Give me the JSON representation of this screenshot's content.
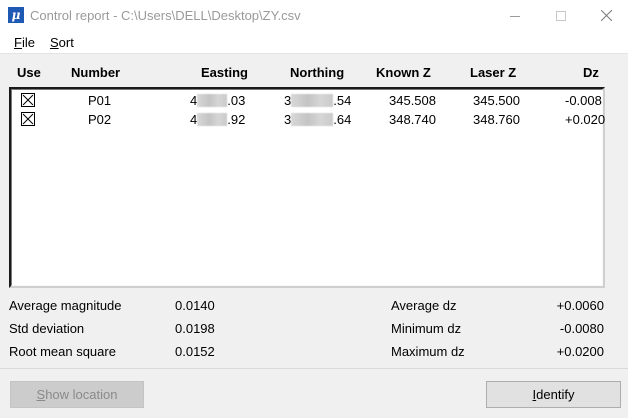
{
  "window": {
    "title": "Control report - C:\\Users\\DELL\\Desktop\\ZY.csv",
    "icon_glyph": "μ"
  },
  "menu": {
    "file_hotkey": "F",
    "file_rest": "ile",
    "sort_hotkey": "S",
    "sort_rest": "ort"
  },
  "columns": {
    "use": "Use",
    "number": "Number",
    "easting": "Easting",
    "northing": "Northing",
    "known_z": "Known Z",
    "laser_z": "Laser Z",
    "dz": "Dz"
  },
  "rows": [
    {
      "checked": true,
      "number": "P01",
      "easting_prefix": "4",
      "easting_suffix": ".03",
      "northing_prefix": "3",
      "northing_suffix": ".54",
      "known_z": "345.508",
      "laser_z": "345.500",
      "dz": "-0.008"
    },
    {
      "checked": true,
      "number": "P02",
      "easting_prefix": "4",
      "easting_suffix": ".92",
      "northing_prefix": "3",
      "northing_suffix": ".64",
      "known_z": "348.740",
      "laser_z": "348.760",
      "dz": "+0.020"
    }
  ],
  "stats": {
    "avg_magnitude_label": "Average magnitude",
    "avg_magnitude_value": "0.0140",
    "std_deviation_label": "Std deviation",
    "std_deviation_value": "0.0198",
    "rms_label": "Root mean square",
    "rms_value": "0.0152",
    "avg_dz_label": "Average dz",
    "avg_dz_value": "+0.0060",
    "min_dz_label": "Minimum dz",
    "min_dz_value": "-0.0080",
    "max_dz_label": "Maximum dz",
    "max_dz_value": "+0.0200"
  },
  "buttons": {
    "show_location_hotkey": "S",
    "show_location_rest": "how location",
    "identify_hotkey": "I",
    "identify_rest": "dentify"
  }
}
